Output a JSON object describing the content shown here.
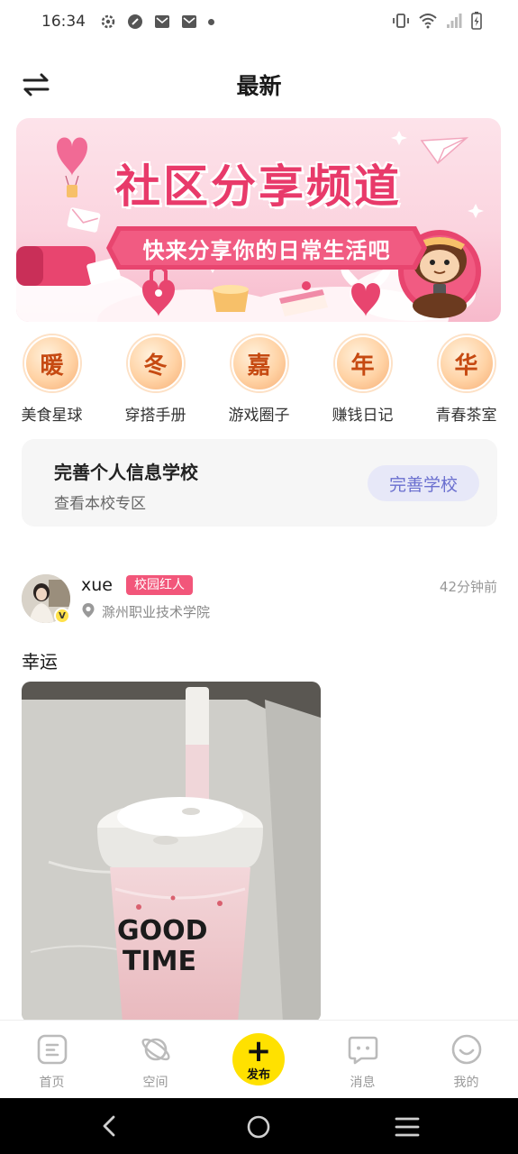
{
  "status_bar": {
    "time": "16:34",
    "icons": [
      "settings-icon",
      "shield-icon",
      "mail-icon",
      "mail-icon",
      "dot-icon",
      "vibrate-icon",
      "wifi-icon",
      "signal-icon",
      "battery-charging-icon"
    ]
  },
  "header": {
    "title": "最新",
    "left_icon": "swap-icon"
  },
  "banner": {
    "title": "社区分享频道",
    "subtitle": "快来分享你的日常生活吧"
  },
  "channels": [
    {
      "badge": "暖",
      "label": "美食星球"
    },
    {
      "badge": "冬",
      "label": "穿搭手册"
    },
    {
      "badge": "嘉",
      "label": "游戏圈子"
    },
    {
      "badge": "年",
      "label": "赚钱日记"
    },
    {
      "badge": "华",
      "label": "青春茶室"
    }
  ],
  "profile_card": {
    "title": "完善个人信息学校",
    "subtitle": "查看本校专区",
    "button": "完善学校"
  },
  "post": {
    "username": "xue",
    "tag": "校园红人",
    "school": "滁州职业技术学院",
    "time": "42分钟前",
    "text": "幸运",
    "image_text": "GOOD\nTIME"
  },
  "tabs": [
    {
      "label": "首页",
      "icon": "home-icon"
    },
    {
      "label": "空间",
      "icon": "planet-icon"
    },
    {
      "label": "发布",
      "icon": "plus-icon"
    },
    {
      "label": "消息",
      "icon": "message-icon"
    },
    {
      "label": "我的",
      "icon": "smile-icon"
    }
  ],
  "nav": {
    "icons": [
      "back-icon",
      "home-circle-icon",
      "menu-icon"
    ]
  },
  "colors": {
    "accent_yellow": "#ffe100",
    "tag_pink": "#f2567a",
    "button_purple": "#6a6fcf"
  }
}
